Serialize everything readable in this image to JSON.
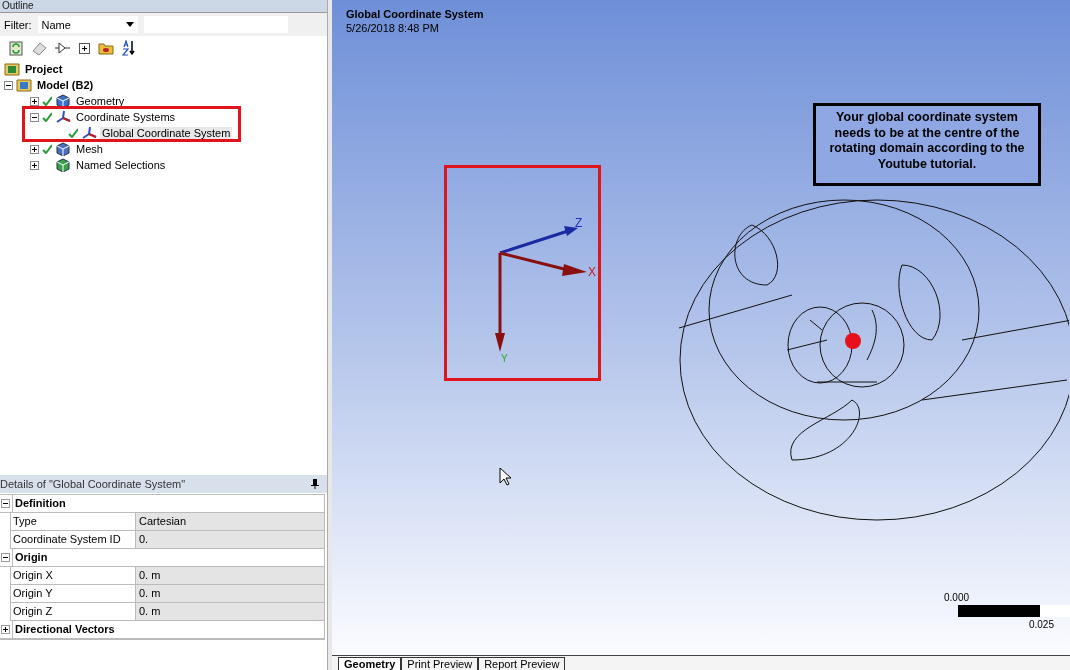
{
  "outline": {
    "title": "Outline",
    "filter_label": "Filter:",
    "filter_value": "Name",
    "tree": [
      {
        "label": "Project",
        "kind": "project",
        "bold": true,
        "children": [
          {
            "label": "Model (B2)",
            "kind": "model",
            "bold": true,
            "expanded": true,
            "children": [
              {
                "label": "Geometry",
                "kind": "geometry",
                "expanded": false,
                "ok": true,
                "selected": false
              },
              {
                "label": "Coordinate Systems",
                "kind": "coord",
                "expanded": true,
                "ok": true,
                "selected": false,
                "children": [
                  {
                    "label": "Global Coordinate System",
                    "kind": "coord",
                    "ok": true,
                    "selected": true
                  }
                ]
              },
              {
                "label": "Mesh",
                "kind": "mesh",
                "expanded": false,
                "ok": true,
                "selected": false
              },
              {
                "label": "Named Selections",
                "kind": "named",
                "expanded": false,
                "ok": false,
                "selected": false
              }
            ]
          }
        ]
      }
    ]
  },
  "details": {
    "title": "Details of \"Global Coordinate System\"",
    "groups": [
      {
        "name": "Definition",
        "expanded": true,
        "rows": [
          {
            "label": "Type",
            "value": "Cartesian"
          },
          {
            "label": "Coordinate System ID",
            "value": "0."
          }
        ]
      },
      {
        "name": "Origin",
        "expanded": true,
        "rows": [
          {
            "label": "Origin X",
            "value": "0. m"
          },
          {
            "label": "Origin Y",
            "value": "0. m"
          },
          {
            "label": "Origin Z",
            "value": "0. m"
          }
        ]
      },
      {
        "name": "Directional Vectors",
        "expanded": false
      }
    ]
  },
  "viewport": {
    "title": "Global Coordinate System",
    "date": "5/26/2018 8:48 PM",
    "note": "Your global coordinate system needs to be at the centre of the rotating domain according to the Youtube tutorial.",
    "axes": {
      "x": "X",
      "y": "Y",
      "z": "Z"
    },
    "scale_start": "0.000",
    "scale_end": "0.025"
  },
  "tabs": [
    {
      "label": "Geometry",
      "selected": true
    },
    {
      "label": "Print Preview",
      "selected": false
    },
    {
      "label": "Report Preview",
      "selected": false
    }
  ]
}
